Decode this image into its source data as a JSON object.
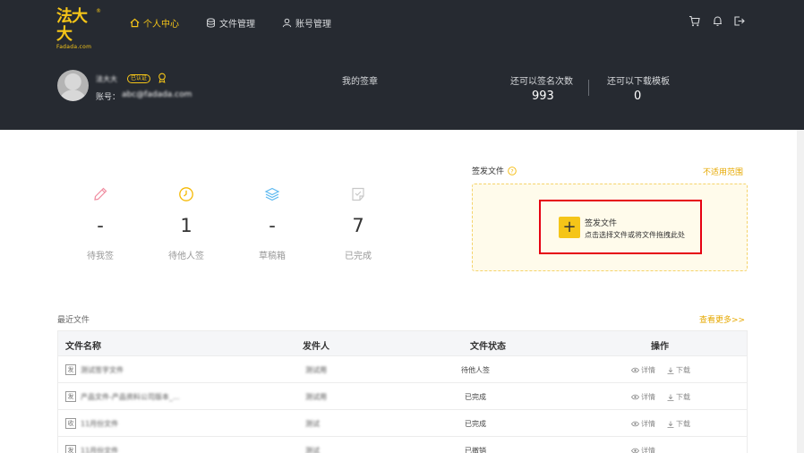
{
  "brand": {
    "name": "法大大",
    "sub": "Fadada.com",
    "reg": "®",
    "color": "#f5c518"
  },
  "nav": {
    "home": "个人中心",
    "files": "文件管理",
    "account": "账号管理"
  },
  "profile": {
    "name": "法大大",
    "verified": "已认证",
    "account_prefix": "账号：",
    "account_value": "abc@fadada.com"
  },
  "stats": {
    "my_seal": "我的签章",
    "sign_remaining_label": "还可以签名次数",
    "sign_remaining_value": "993",
    "tpl_remaining_label": "还可以下载模板",
    "tpl_remaining_value": "0"
  },
  "cards": [
    {
      "count": "-",
      "label": "待我签"
    },
    {
      "count": "1",
      "label": "待他人签"
    },
    {
      "count": "-",
      "label": "草稿箱"
    },
    {
      "count": "7",
      "label": "已完成"
    }
  ],
  "send": {
    "title": "签发文件",
    "scope_link": "不适用范围",
    "plus": "+",
    "drop_title": "签发文件",
    "drop_hint": "点击选择文件或将文件拖拽此处"
  },
  "recent": {
    "title": "最近文件",
    "more": "查看更多>>",
    "columns": [
      "文件名称",
      "发件人",
      "文件状态",
      "操作"
    ],
    "detail_label": "详情",
    "download_label": "下载",
    "rows": [
      {
        "icon": "发",
        "name": "测试签字文件",
        "sender": "测试用",
        "status": "待他人签"
      },
      {
        "icon": "发",
        "name": "产品文件-产品资料公司版本_...",
        "sender": "测试用",
        "status": "已完成"
      },
      {
        "icon": "收",
        "name": "11月份文件",
        "sender": "测试",
        "status": "已完成"
      },
      {
        "icon": "发",
        "name": "11月份文件",
        "sender": "测试",
        "status": "已撤销"
      }
    ]
  }
}
